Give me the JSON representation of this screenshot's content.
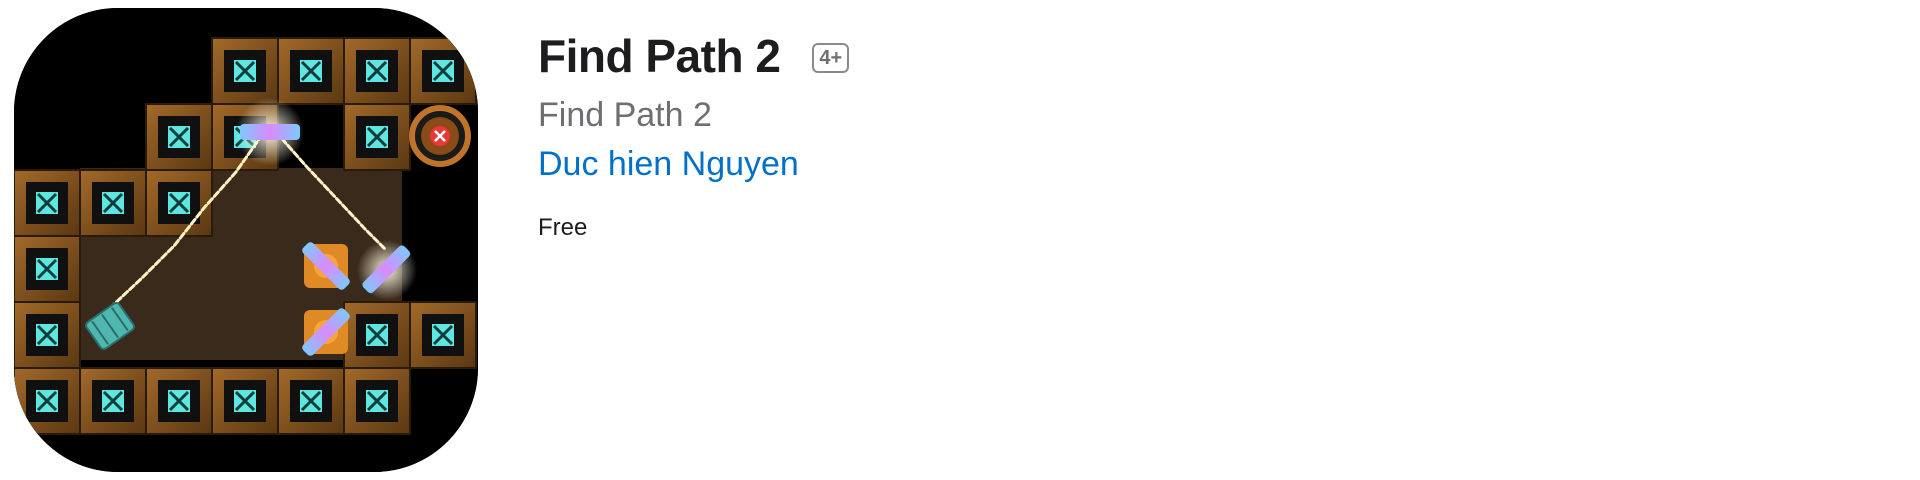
{
  "app": {
    "title": "Find Path 2",
    "age_rating": "4+",
    "subtitle": "Find Path 2",
    "developer": "Duc hien Nguyen",
    "price": "Free"
  },
  "icon": {
    "name": "find-path-2-app-icon"
  },
  "colors": {
    "background": "#ffffff",
    "title": "#1d1d1f",
    "secondary_text": "#6e6e73",
    "link": "#0070c9",
    "tile_frame": "#7a4f1e",
    "tile_cross": "#5ee6e0",
    "laser": "#fff3c4",
    "mirror": "#c98cff"
  }
}
